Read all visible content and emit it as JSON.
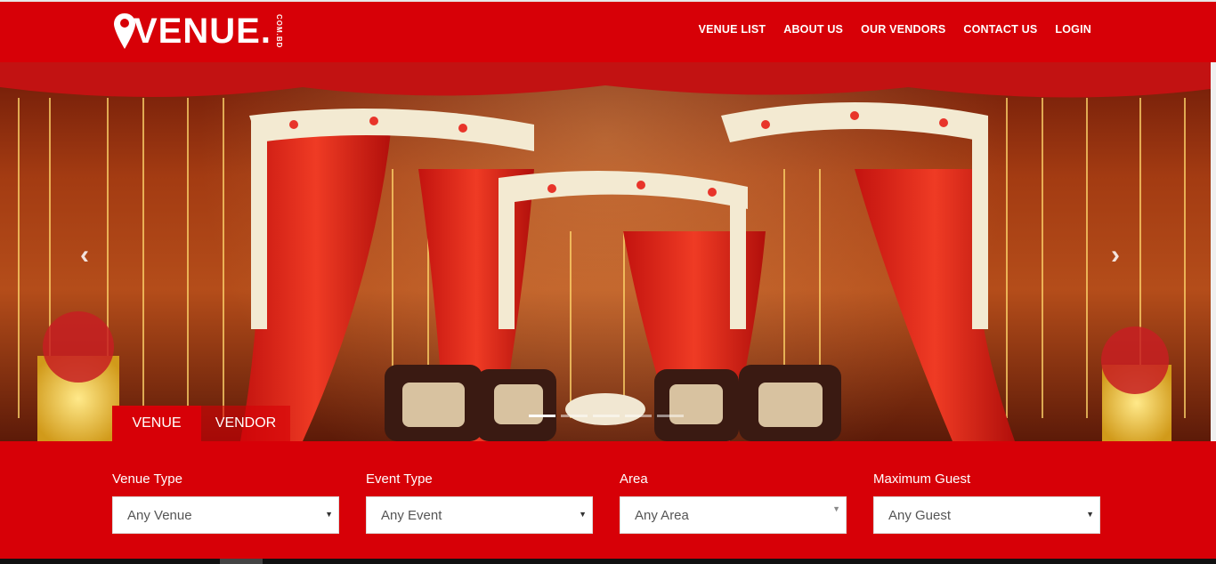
{
  "header": {
    "logo_text": "VENUE.",
    "logo_sub": "COM.BD",
    "nav": [
      "VENUE LIST",
      "ABOUT US",
      "OUR VENDORS",
      "CONTACT US",
      "LOGIN"
    ]
  },
  "hero": {
    "tabs": [
      "VENUE",
      "VENDOR"
    ],
    "slides_count": 5,
    "active_slide": 1
  },
  "search": {
    "fields": [
      {
        "label": "Venue Type",
        "value": "Any Venue"
      },
      {
        "label": "Event Type",
        "value": "Any Event"
      },
      {
        "label": "Area",
        "value": "Any Area"
      },
      {
        "label": "Maximum Guest",
        "value": "Any Guest"
      }
    ]
  },
  "colors": {
    "brand": "#d70007"
  },
  "icons": {
    "prev": "chevron-left-icon",
    "next": "chevron-right-icon",
    "dropdown": "caret-down-icon"
  }
}
